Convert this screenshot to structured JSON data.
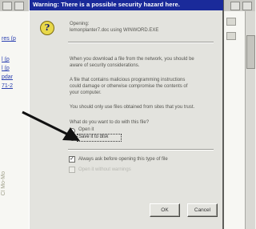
{
  "browser": {
    "left_links": [
      "res (p",
      "l (p",
      "l (p",
      "pdar",
      "71-2"
    ],
    "vertical_label": "Cl Mo-Mo"
  },
  "dialog": {
    "title": "Warning: There is a possible security hazard here.",
    "opening_label": "Opening:",
    "opening_file": "lemonplanter7.doc using WINWORD.EXE",
    "para1": [
      "When you download a file from the network, you should be",
      "aware of security considerations."
    ],
    "para2": [
      "A file that contains malicious programming instructions",
      "could damage or otherwise compromise the contents of",
      "your computer."
    ],
    "para3": [
      "You should only use files obtained from sites that you trust."
    ],
    "question": "What do you want to do with this file?",
    "option_open": "Open it",
    "option_save": "Save it to disk",
    "checkbox_always": "Always ask before opening this type of file",
    "checkbox_disabled": "Open it without warnings",
    "ok_label": "OK",
    "cancel_label": "Cancel",
    "icon": "question-icon"
  },
  "colors": {
    "titlebar": "#1a2a9a",
    "dialog_bg": "#e3e3de",
    "link": "#2a3fb0"
  }
}
